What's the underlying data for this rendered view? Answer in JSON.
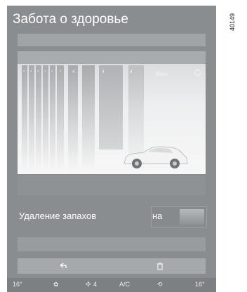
{
  "header": {
    "title": "Забота о здоровье"
  },
  "panel": {
    "segment_labels": [
      "⁴",
      "⁴",
      "⁴",
      "⁴",
      "⁴",
      "⁴",
      "4",
      "4",
      "4"
    ],
    "mode_text": "Slow",
    "icons": [
      "car-icon",
      "info-icon"
    ]
  },
  "deodorization": {
    "label": "Удаление запахов",
    "state": "на",
    "enabled": true
  },
  "actions": {
    "back_icon": "back-arrow-icon",
    "delete_icon": "trash-icon"
  },
  "status_bar": {
    "temp_left": "16°",
    "fan_icon": "fan-icon",
    "fan_level": "4",
    "ac_label": "A/C",
    "recirc_icon": "recirculation-icon",
    "temp_right": "16°"
  },
  "side_code": "40149"
}
